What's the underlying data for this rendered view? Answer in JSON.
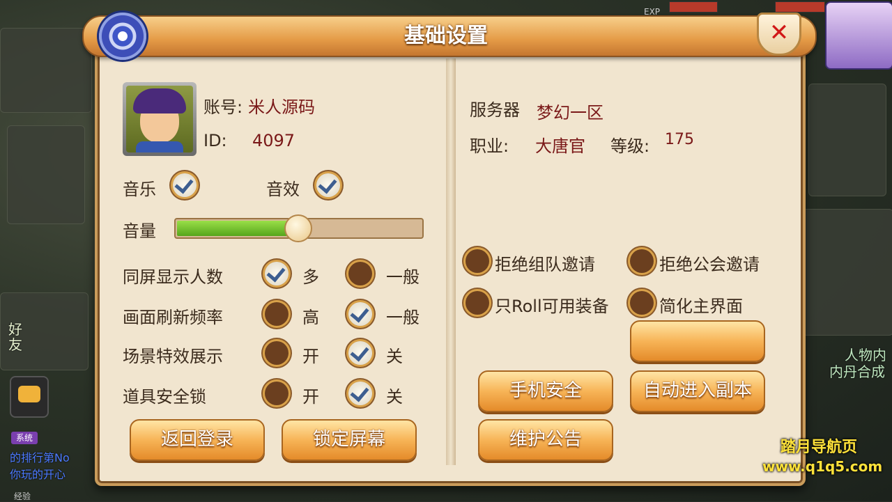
{
  "title": "基础设置",
  "account": {
    "label": "账号:",
    "value": "米人源码",
    "id_label": "ID:",
    "id_value": "4097"
  },
  "server": {
    "label": "服务器",
    "value": "梦幻一区"
  },
  "profession": {
    "label": "职业:",
    "value": "大唐官",
    "level_label": "等级:",
    "level_value": "175"
  },
  "sound": {
    "music_label": "音乐",
    "music_on": true,
    "sfx_label": "音效",
    "sfx_on": true
  },
  "volume": {
    "label": "音量",
    "level": 0.49
  },
  "settings": [
    {
      "label": "同屏显示人数",
      "opt1": "多",
      "opt2": "一般",
      "selected": 1
    },
    {
      "label": "画面刷新频率",
      "opt1": "高",
      "opt2": "一般",
      "selected": 2
    },
    {
      "label": "场景特效展示",
      "opt1": "开",
      "opt2": "关",
      "selected": 2
    },
    {
      "label": "道具安全锁",
      "opt1": "开",
      "opt2": "关",
      "selected": 2
    }
  ],
  "toggles": [
    {
      "label": "拒绝组队邀请",
      "on": false
    },
    {
      "label": "拒绝公会邀请",
      "on": false
    },
    {
      "label": "只Roll可用装备",
      "on": false
    },
    {
      "label": "简化主界面",
      "on": false
    }
  ],
  "buttons": {
    "back_login": "返回登录",
    "lock_screen": "锁定屏幕",
    "phone_security": "手机安全",
    "auto_dungeon": "自动进入副本",
    "maintenance": "维护公告",
    "blank": ""
  },
  "hud": {
    "exp": "EXP",
    "friend": "好友",
    "sys_tag": "系统",
    "chat1": "的排行第No",
    "chat2": "你玩的开心",
    "side1": "人物内",
    "side2": "内丹合成",
    "bottom_exp": "经验"
  },
  "watermark": {
    "line1": "踏月导航页",
    "line2": "www.q1q5.com"
  }
}
